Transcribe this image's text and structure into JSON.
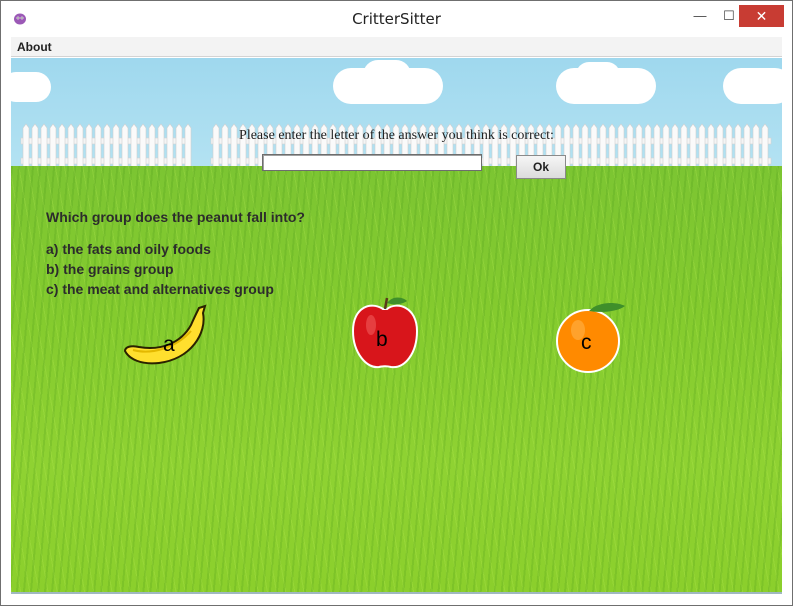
{
  "window": {
    "title": "CritterSitter",
    "minimize_glyph": "—",
    "maximize_glyph": "☐",
    "close_glyph": "✕"
  },
  "menu": {
    "items": [
      "About"
    ]
  },
  "prompt": {
    "text": "Please enter the letter of the answer you think is correct:",
    "input_value": "",
    "ok_label": "Ok"
  },
  "question": {
    "text": "Which group does the peanut fall into?",
    "options": [
      "a) the fats and oily foods",
      "b) the grains group",
      "c) the meat and alternatives group"
    ]
  },
  "fruits": [
    {
      "name": "banana",
      "letter": "a",
      "color": "#ffe03a"
    },
    {
      "name": "apple",
      "letter": "b",
      "color": "#d9161c"
    },
    {
      "name": "orange",
      "letter": "c",
      "color": "#ff8a00"
    }
  ]
}
